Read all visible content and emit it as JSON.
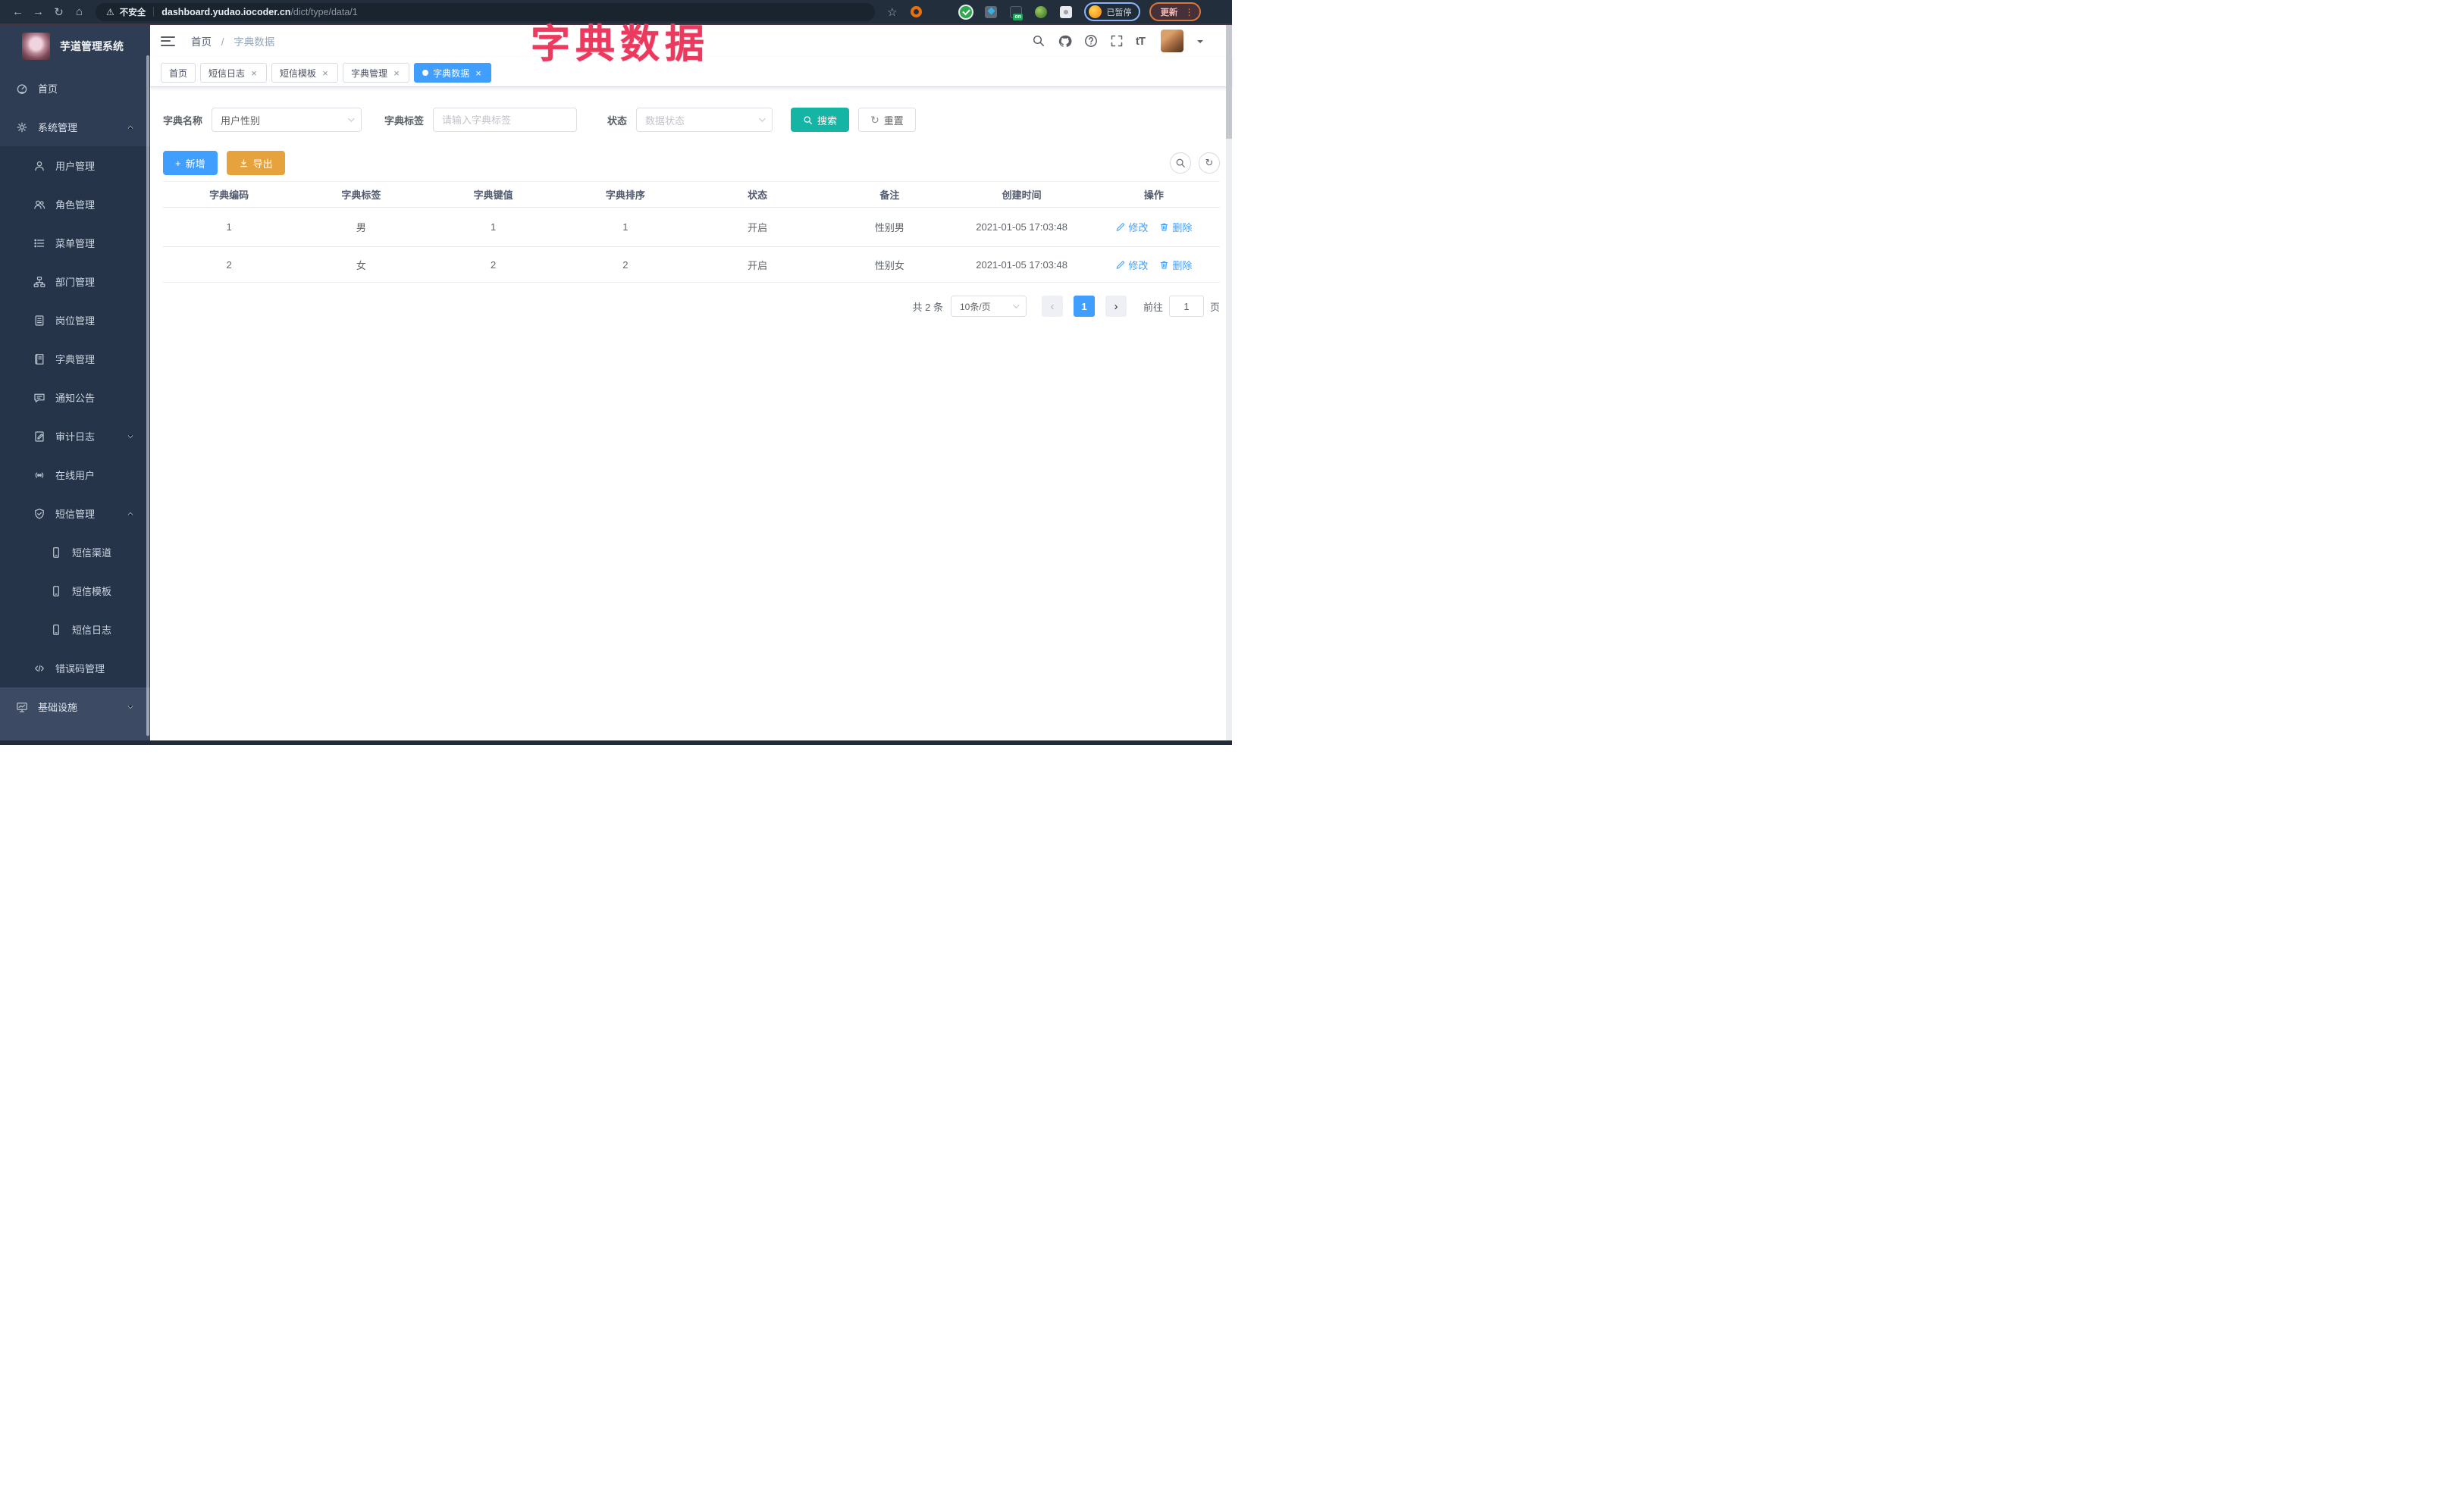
{
  "browser": {
    "glyphs": {
      "back": "←",
      "forward": "→",
      "reload": "↻",
      "home": "⌂",
      "warning": "⚠",
      "star": "☆",
      "kebab": "⋮"
    },
    "security_label": "不安全",
    "url_host": "dashboard.yudao.iocoder.cn",
    "url_path": "/dict/type/data/1",
    "ext_badge": "on",
    "profile_status": "已暂停",
    "update_label": "更新"
  },
  "overlay": {
    "title": "字典数据",
    "color": "#ec3a5f"
  },
  "sidebar": {
    "app_title": "芋道管理系统",
    "items": [
      {
        "label": "首页",
        "level": 0,
        "icon": "dashboard-icon"
      },
      {
        "label": "系统管理",
        "level": 0,
        "icon": "gear-icon",
        "chevron": "up"
      },
      {
        "label": "用户管理",
        "level": 1,
        "icon": "user-icon"
      },
      {
        "label": "角色管理",
        "level": 1,
        "icon": "users-icon"
      },
      {
        "label": "菜单管理",
        "level": 1,
        "icon": "menu-list-icon"
      },
      {
        "label": "部门管理",
        "level": 1,
        "icon": "org-tree-icon"
      },
      {
        "label": "岗位管理",
        "level": 1,
        "icon": "badge-icon"
      },
      {
        "label": "字典管理",
        "level": 1,
        "icon": "book-icon"
      },
      {
        "label": "通知公告",
        "level": 1,
        "icon": "announcement-icon"
      },
      {
        "label": "审计日志",
        "level": 1,
        "icon": "audit-log-icon",
        "chevron": "down"
      },
      {
        "label": "在线用户",
        "level": 1,
        "icon": "online-users-icon"
      },
      {
        "label": "短信管理",
        "level": 1,
        "icon": "shield-icon",
        "chevron": "up"
      },
      {
        "label": "短信渠道",
        "level": 2,
        "icon": "phone-icon"
      },
      {
        "label": "短信模板",
        "level": 2,
        "icon": "phone-icon"
      },
      {
        "label": "短信日志",
        "level": 2,
        "icon": "phone-icon"
      },
      {
        "label": "错误码管理",
        "level": 1,
        "icon": "code-icon"
      },
      {
        "label": "基础设施",
        "level": 0,
        "icon": "monitor-icon",
        "chevron": "down"
      }
    ]
  },
  "navbar": {
    "breadcrumb": {
      "home": "首页",
      "separator": "/",
      "current": "字典数据"
    },
    "font_icon": "tT"
  },
  "tabs": {
    "close_glyph": "×",
    "items": [
      {
        "label": "首页",
        "closable": false,
        "active": false
      },
      {
        "label": "短信日志",
        "closable": true,
        "active": false
      },
      {
        "label": "短信模板",
        "closable": true,
        "active": false
      },
      {
        "label": "字典管理",
        "closable": true,
        "active": false
      },
      {
        "label": "字典数据",
        "closable": true,
        "active": true
      }
    ]
  },
  "filters": {
    "dict_name_label": "字典名称",
    "dict_name_value": "用户性别",
    "dict_label_label": "字典标签",
    "dict_label_placeholder": "请输入字典标签",
    "status_label": "状态",
    "status_placeholder": "数据状态",
    "search_label": "搜索",
    "reset_label": "重置",
    "reset_glyph": "↻"
  },
  "toolbar": {
    "add_label": "新增",
    "plus_glyph": "+",
    "export_label": "导出",
    "refresh_glyph": "↻"
  },
  "table": {
    "headers": [
      "字典编码",
      "字典标签",
      "字典键值",
      "字典排序",
      "状态",
      "备注",
      "创建时间",
      "操作"
    ],
    "rows": [
      {
        "code": "1",
        "label": "男",
        "value": "1",
        "sort": "1",
        "status": "开启",
        "remark": "性别男",
        "created": "2021-01-05 17:03:48"
      },
      {
        "code": "2",
        "label": "女",
        "value": "2",
        "sort": "2",
        "status": "开启",
        "remark": "性别女",
        "created": "2021-01-05 17:03:48"
      }
    ],
    "edit_label": "修改",
    "delete_label": "删除"
  },
  "pagination": {
    "total_text": "共 2 条",
    "page_size": "10条/页",
    "prev_glyph": "‹",
    "next_glyph": "›",
    "current_page": "1",
    "goto_label": "前往",
    "goto_value": "1",
    "page_unit": "页"
  },
  "colors": {
    "accent_blue": "#409eff",
    "search_teal": "#15b5a5",
    "export_orange": "#e6a23c",
    "overlay_pink": "#ec3a5f",
    "sidebar_bg": "#2e3d53",
    "submenu_bg": "#253449",
    "chrome_bg": "#232e3d"
  }
}
